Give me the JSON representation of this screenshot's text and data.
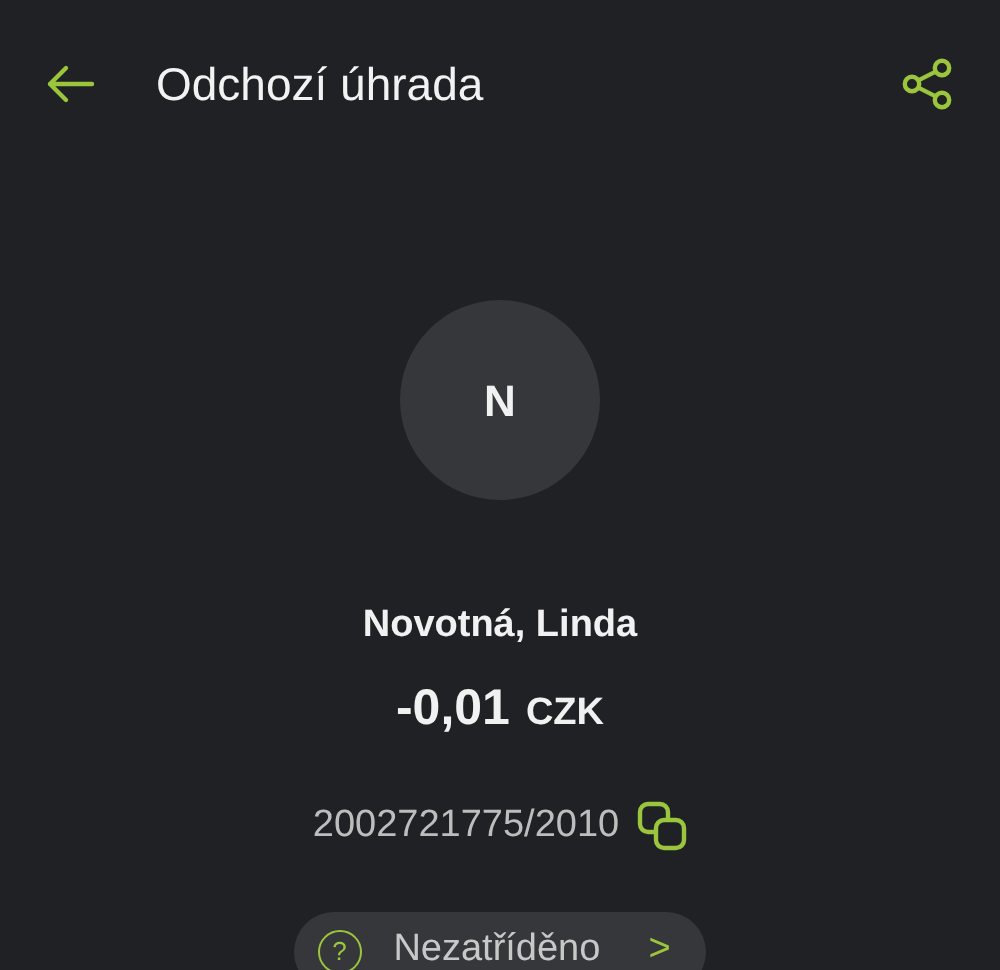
{
  "header": {
    "title": "Odchozí úhrada"
  },
  "counterparty": {
    "initial": "N",
    "name": "Novotná, Linda"
  },
  "amount": {
    "value": "-0,01",
    "currency": "CZK"
  },
  "account": {
    "number": "2002721775/2010"
  },
  "category": {
    "label": "Nezatříděno",
    "icon": "?",
    "chevron": ">"
  }
}
